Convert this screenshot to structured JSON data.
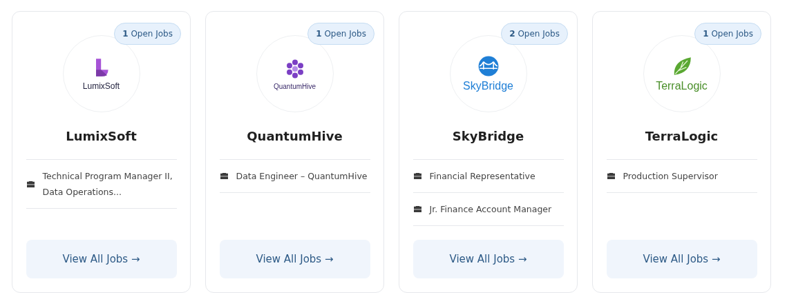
{
  "companies": [
    {
      "badge": "**1** Open Jobs",
      "logo": {
        "kind": "l-mark",
        "text": "LumixSoft"
      },
      "name": "LumixSoft",
      "jobs": [
        "Technical Program Manager II, Data Operations..."
      ],
      "button": "View All Jobs →"
    },
    {
      "badge": "**1** Open Jobs",
      "logo": {
        "kind": "hex",
        "text": "QuantumHive"
      },
      "name": "QuantumHive",
      "jobs": [
        "Data Engineer – QuantumHive"
      ],
      "button": "View All Jobs →"
    },
    {
      "badge": "**2** Open Jobs",
      "logo": {
        "kind": "bridge",
        "text": "SkyBridge"
      },
      "name": "SkyBridge",
      "jobs": [
        "Financial Representative",
        "Jr. Finance Account Manager"
      ],
      "button": "View All Jobs →"
    },
    {
      "badge": "**1** Open Jobs",
      "logo": {
        "kind": "leaf",
        "text": "TerraLogic"
      },
      "name": "TerraLogic",
      "jobs": [
        "Production Supervisor"
      ],
      "button": "View All Jobs →"
    }
  ]
}
